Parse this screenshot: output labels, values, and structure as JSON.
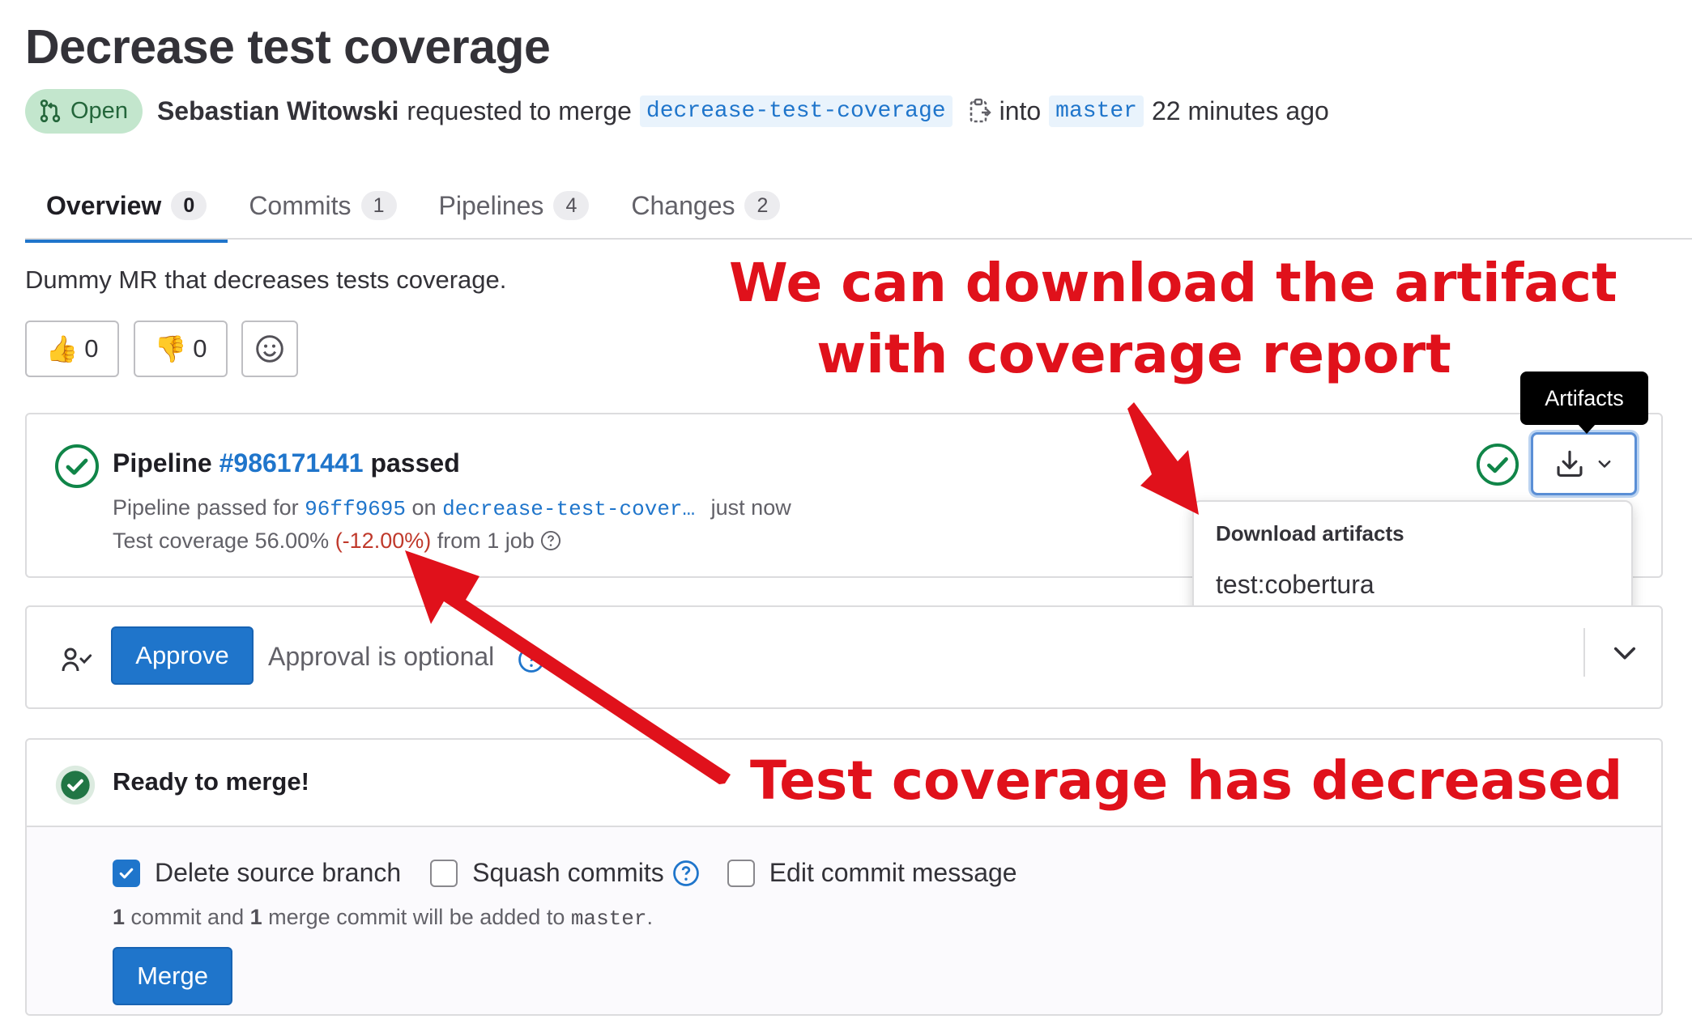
{
  "header": {
    "title": "Decrease test coverage",
    "status_badge": "Open",
    "author": "Sebastian Witowski",
    "action_text": "requested to merge",
    "source_branch": "decrease-test-coverage",
    "into_text": "into",
    "target_branch": "master",
    "time_ago": "22 minutes ago"
  },
  "tabs": [
    {
      "label": "Overview",
      "count": "0"
    },
    {
      "label": "Commits",
      "count": "1"
    },
    {
      "label": "Pipelines",
      "count": "4"
    },
    {
      "label": "Changes",
      "count": "2"
    }
  ],
  "description": "Dummy MR that decreases tests coverage.",
  "reactions": {
    "thumbs_up_count": "0",
    "thumbs_down_count": "0"
  },
  "pipeline": {
    "title_prefix": "Pipeline",
    "id": "#986171441",
    "title_suffix": "passed",
    "passed_for_text": "Pipeline passed for",
    "commit": "96ff9695",
    "on_text": "on",
    "branch": "decrease-test-cover…",
    "time": "just now",
    "coverage_text": "Test coverage 56.00%",
    "coverage_delta": "(-12.00%)",
    "from_text": "from 1 job"
  },
  "artifacts": {
    "tooltip": "Artifacts",
    "dropdown_header": "Download artifacts",
    "items": [
      "test:cobertura"
    ]
  },
  "approval": {
    "button": "Approve",
    "text": "Approval is optional"
  },
  "merge": {
    "title": "Ready to merge!",
    "options": [
      {
        "label": "Delete source branch",
        "checked": true
      },
      {
        "label": "Squash commits",
        "checked": false
      },
      {
        "label": "Edit commit message",
        "checked": false
      }
    ],
    "note_count1": "1",
    "note_text1": "commit and",
    "note_count2": "1",
    "note_text2": "merge commit will be added to",
    "note_branch": "master",
    "note_end": ".",
    "button": "Merge"
  },
  "annotations": {
    "top_line1": "We can download the artifact",
    "top_line2": "with coverage report",
    "bottom": "Test coverage has decreased"
  },
  "colors": {
    "accent": "#1f75cb",
    "success": "#108548",
    "annotation": "#e0111b",
    "coverage_drop": "#c0392b"
  }
}
